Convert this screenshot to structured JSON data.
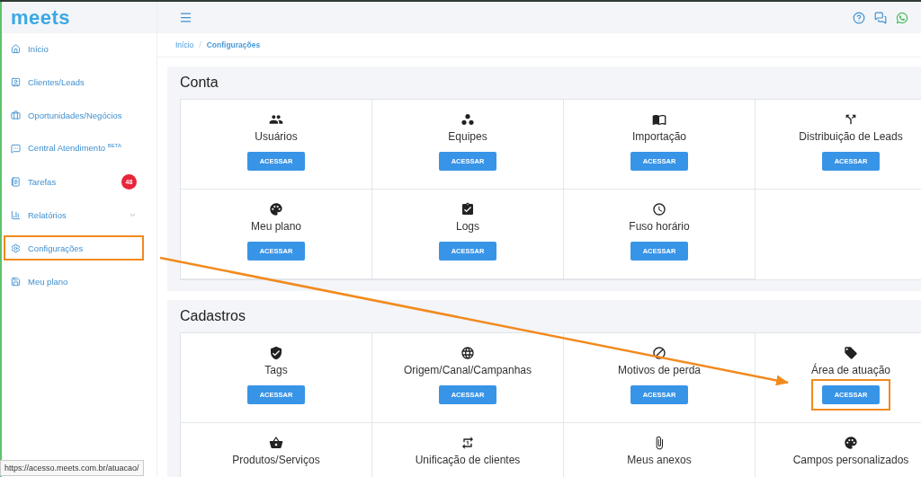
{
  "logo": "meets",
  "sidebar": {
    "items": [
      {
        "label": "Início",
        "expandable": false,
        "highlighted": false
      },
      {
        "label": "Clientes/Leads",
        "expandable": false,
        "highlighted": false
      },
      {
        "label": "Oportunidades/Negócios",
        "expandable": false,
        "highlighted": false
      },
      {
        "label": "Central Atendimento $^{BETA}$",
        "expandable": false,
        "highlighted": false
      },
      {
        "label": "Tarefas",
        "badge": "48",
        "expandable": false,
        "highlighted": false
      },
      {
        "label": "Relatórios",
        "expandable": true,
        "highlighted": false
      },
      {
        "label": "Configurações",
        "expandable": false,
        "highlighted": true
      },
      {
        "label": "Meu plano",
        "expandable": false,
        "highlighted": false
      }
    ]
  },
  "breadcrumb": {
    "separator": "/",
    "items": [
      {
        "label": "Início",
        "selected": false
      },
      {
        "label": "Configurações",
        "selected": true
      }
    ]
  },
  "sections": [
    {
      "title": "Conta",
      "cards": [
        {
          "label": "Usuários",
          "button": "ACESSAR",
          "highlighted": false
        },
        {
          "label": "Equipes",
          "button": "ACESSAR",
          "highlighted": false
        },
        {
          "label": "Importação",
          "button": "ACESSAR",
          "highlighted": false
        },
        {
          "label": "Distribuição de Leads",
          "button": "ACESSAR",
          "highlighted": false
        },
        {
          "label": "Meu plano",
          "button": "ACESSAR",
          "highlighted": false
        },
        {
          "label": "Logs",
          "button": "ACESSAR",
          "highlighted": false
        },
        {
          "label": "Fuso horário",
          "button": "ACESSAR",
          "highlighted": false
        }
      ]
    },
    {
      "title": "Cadastros",
      "cards": [
        {
          "label": "Tags",
          "button": "ACESSAR",
          "highlighted": false
        },
        {
          "label": "Origem/Canal/Campanhas",
          "button": "ACESSAR",
          "highlighted": false
        },
        {
          "label": "Motivos de perda",
          "button": "ACESSAR",
          "highlighted": false
        },
        {
          "label": "Área de atuação",
          "button": "ACESSAR",
          "highlighted": true
        },
        {
          "label": "Produtos/Serviços",
          "highlighted": false
        },
        {
          "label": "Unificação de clientes",
          "highlighted": false
        },
        {
          "label": "Meus anexos",
          "highlighted": false
        },
        {
          "label": "Campos personalizados",
          "highlighted": false
        }
      ]
    }
  ],
  "status_url": "https://acesso.meets.com.br/atuacao/"
}
